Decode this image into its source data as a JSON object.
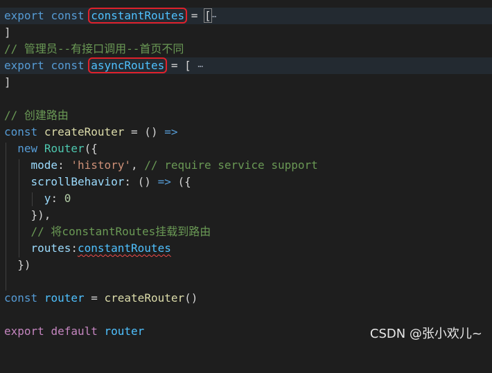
{
  "editor": {
    "lines": {
      "l1": {
        "kw1": "export",
        "kw2": "const",
        "name": "constantRoutes",
        "eq": " = ",
        "open": "[",
        "fold": "⋯"
      },
      "l2": {
        "close": "]"
      },
      "l3": {
        "comment": "// 管理员--有接口调用--首页不同"
      },
      "l4": {
        "kw1": "export",
        "kw2": "const",
        "name": "asyncRoutes",
        "eq": " = [ ",
        "fold": "⋯"
      },
      "l5": {
        "close": "]"
      },
      "l7": {
        "comment": "// 创建路由"
      },
      "l8": {
        "kw": "const",
        "name": "createRouter",
        "rest": " = () ",
        "arrow": "=>"
      },
      "l9": {
        "kw": "new",
        "cls": "Router",
        "rest": "({"
      },
      "l10": {
        "prop": "mode",
        "colon": ": ",
        "str": "'history'",
        "comma": ", ",
        "comment": "// require service support"
      },
      "l11": {
        "prop": "scrollBehavior",
        "rest": ": () ",
        "arrow": "=>",
        "rest2": " ({"
      },
      "l12": {
        "prop": "y",
        "colon": ": ",
        "num": "0"
      },
      "l13": {
        "text": "}),"
      },
      "l14": {
        "comment": "// 将constantRoutes挂载到路由"
      },
      "l15": {
        "prop": "routes",
        "colon": ":",
        "val": "constantRoutes"
      },
      "l16": {
        "text": "})"
      },
      "l18": {
        "kw": "const",
        "name": "router",
        "rest": " = ",
        "fn": "createRouter",
        "call": "()"
      },
      "l20": {
        "kw1": "export",
        "kw2": "default",
        "name": "router"
      }
    }
  },
  "watermark": "CSDN @张小欢儿~",
  "colors": {
    "background": "#1e1e1e",
    "highlight_box": "#e0212b",
    "keyword": "#569cd6",
    "comment": "#6a9955",
    "string": "#ce9178"
  }
}
